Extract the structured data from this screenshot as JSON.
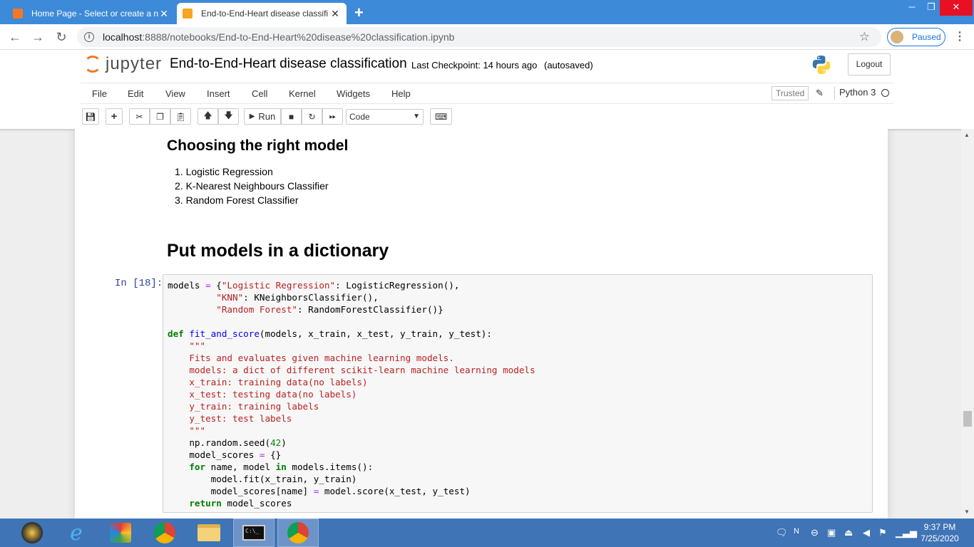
{
  "browser": {
    "tabs": [
      {
        "title": "Home Page - Select or create a n",
        "active": false
      },
      {
        "title": "End-to-End-Heart disease classifi",
        "active": true
      }
    ],
    "url_host": "localhost",
    "url_path": ":8888/notebooks/End-to-End-Heart%20disease%20classification.ipynb",
    "profile_status": "Paused"
  },
  "jupyter": {
    "logo_text": "jupyter",
    "notebook_title": "End-to-End-Heart disease classification",
    "checkpoint": "Last Checkpoint: 14 hours ago",
    "autosave": "(autosaved)",
    "logout_label": "Logout",
    "menu": [
      "File",
      "Edit",
      "View",
      "Insert",
      "Cell",
      "Kernel",
      "Widgets",
      "Help"
    ],
    "trusted_label": "Trusted",
    "kernel_name": "Python 3",
    "run_label": "Run",
    "cell_type": "Code"
  },
  "notebook": {
    "heading1": "Choosing the right model",
    "list": [
      "1. Logistic Regression",
      "2. K-Nearest Neighbours Classifier",
      "3. Random Forest Classifier"
    ],
    "heading2": "Put models in a dictionary",
    "prompt": "In [18]:"
  },
  "taskbar": {
    "time": "9:37 PM",
    "date": "7/25/2020"
  },
  "colors": {
    "tabbar": "#3d8ad8",
    "jupyter_orange": "#f37726",
    "taskbar": "#3f74b6"
  }
}
